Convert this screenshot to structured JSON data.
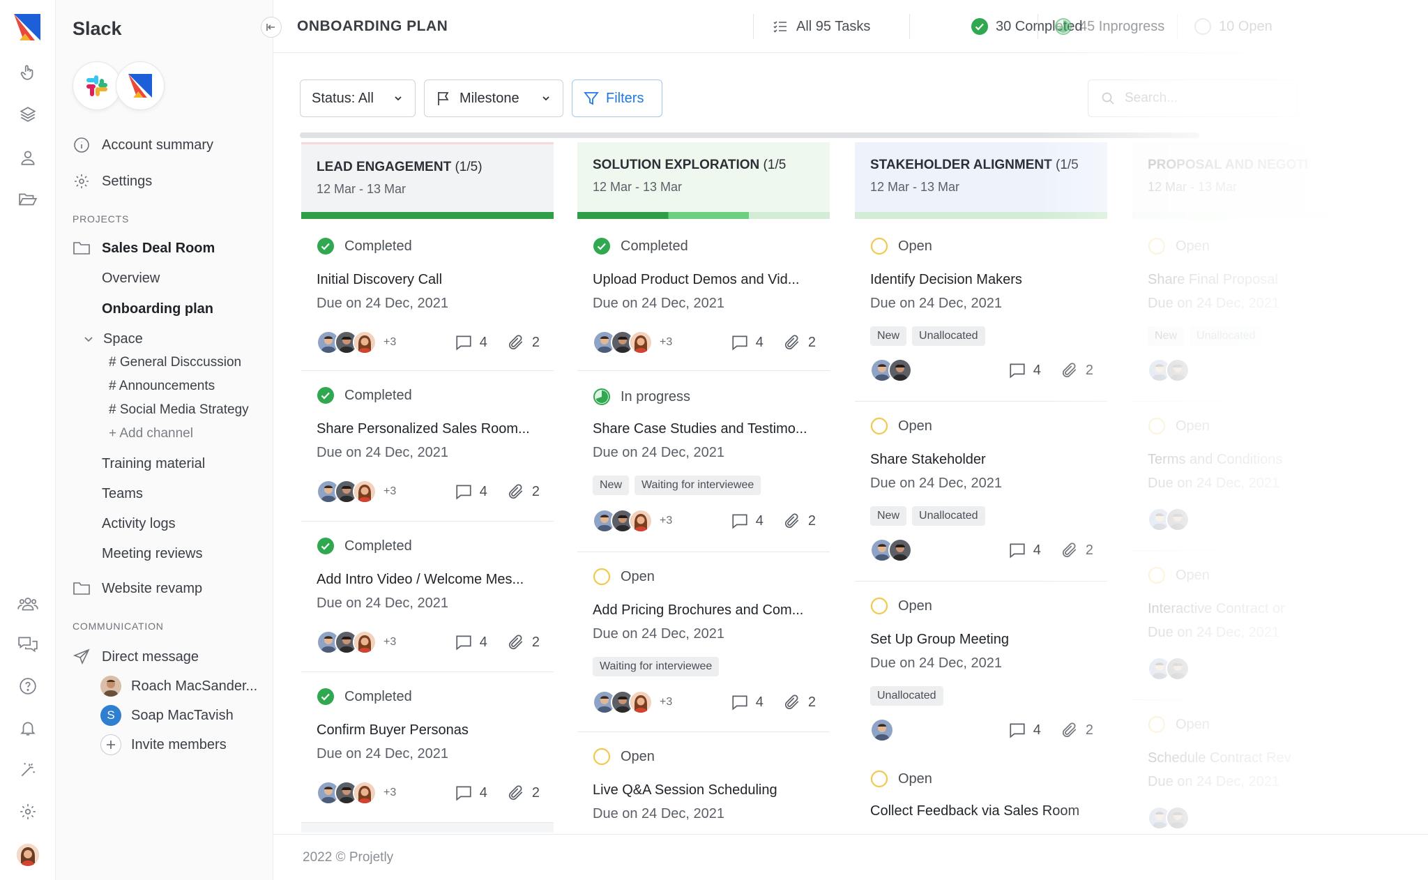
{
  "workspace": {
    "name": "Slack",
    "logos": [
      "slack-logo",
      "projetly-logo"
    ]
  },
  "rail": {
    "items": [
      "hand-pointer-icon",
      "layers-icon",
      "user-icon",
      "folder-open-icon",
      "team-icon",
      "chat-icon",
      "help-icon",
      "bell-icon",
      "magic-wand-icon",
      "gear-icon"
    ]
  },
  "sidebar": {
    "account_summary": "Account summary",
    "settings": "Settings",
    "projects_label": "PROJECTS",
    "projects": [
      {
        "name": "Sales Deal Room"
      },
      {
        "name": "Website revamp"
      }
    ],
    "project_items": {
      "overview": "Overview",
      "onboarding": "Onboarding plan",
      "space": "Space",
      "channels": [
        "# General Disccussion",
        "# Announcements",
        "# Social Media Strategy"
      ],
      "add_channel": "+ Add channel",
      "training": "Training material",
      "teams": "Teams",
      "activity": "Activity logs",
      "meetings": "Meeting reviews"
    },
    "communication_label": "COMMUNICATION",
    "direct_message": "Direct message",
    "dms": [
      {
        "name": "Roach MacSander...",
        "initial": ""
      },
      {
        "name": "Soap MacTavish",
        "initial": "S"
      }
    ],
    "invite": "Invite members"
  },
  "topbar": {
    "title": "ONBOARDING PLAN",
    "all_tasks": "All 95 Tasks",
    "completed": "30 Completed",
    "inprogress": "45 Inprogress",
    "open": "10 Open"
  },
  "toolbar": {
    "status": "Status: All",
    "milestone": "Milestone",
    "filters": "Filters",
    "search_placeholder": "Search..."
  },
  "columns": [
    {
      "title": "LEAD ENGAGEMENT",
      "count": "(1/5)",
      "dates": "12 Mar - 13 Mar",
      "progress": 1.0,
      "cards": [
        {
          "status": "Completed",
          "title": "Initial Discovery Call",
          "due": "Due on 24 Dec, 2021",
          "more": "+3",
          "comments": "4",
          "attachments": "2"
        },
        {
          "status": "Completed",
          "title": "Share Personalized Sales Room...",
          "due": "Due on 24 Dec, 2021",
          "more": "+3",
          "comments": "4",
          "attachments": "2"
        },
        {
          "status": "Completed",
          "title": "Add Intro Video / Welcome Mes...",
          "due": "Due on 24 Dec, 2021",
          "more": "+3",
          "comments": "4",
          "attachments": "2"
        },
        {
          "status": "Completed",
          "title": "Confirm Buyer Personas",
          "due": "Due on 24 Dec, 2021",
          "more": "+3",
          "comments": "4",
          "attachments": "2"
        }
      ]
    },
    {
      "title": "SOLUTION EXPLORATION",
      "count": "(1/5",
      "dates": "12 Mar - 13 Mar",
      "progress": 0.68,
      "cards": [
        {
          "status": "Completed",
          "title": "Upload Product Demos and Vid...",
          "due": "Due on 24 Dec, 2021",
          "more": "+3",
          "comments": "4",
          "attachments": "2"
        },
        {
          "status": "In progress",
          "title": "Share Case Studies and Testimo...",
          "due": "Due on 24 Dec, 2021",
          "tags": [
            "New",
            "Waiting for interviewee"
          ],
          "more": "+3",
          "comments": "4",
          "attachments": "2"
        },
        {
          "status": "Open",
          "title": "Add Pricing Brochures and Com...",
          "due": "Due on 24 Dec, 2021",
          "tags": [
            "Waiting for interviewee"
          ],
          "more": "+3",
          "comments": "4",
          "attachments": "2"
        },
        {
          "status": "Open",
          "title": "Live Q&A Session Scheduling",
          "due": "Due on 24 Dec, 2021"
        }
      ]
    },
    {
      "title": "STAKEHOLDER ALIGNMENT",
      "count": "(1/5",
      "dates": "12 Mar - 13 Mar",
      "progress": 0,
      "cards": [
        {
          "status": "Open",
          "title": "Identify Decision Makers",
          "due": "Due on 24 Dec, 2021",
          "tags": [
            "New",
            "Unallocated"
          ],
          "comments": "4",
          "attachments": "2"
        },
        {
          "status": "Open",
          "title": "Share Stakeholder",
          "due": "Due on 24 Dec, 2021",
          "tags": [
            "New",
            "Unallocated"
          ],
          "comments": "4",
          "attachments": "2"
        },
        {
          "status": "Open",
          "title": "Set Up Group Meeting",
          "due": "Due on 24 Dec, 2021",
          "tags": [
            "Unallocated"
          ],
          "comments": "4",
          "attachments": "2"
        },
        {
          "status": "Open",
          "title": "Collect Feedback via Sales Room"
        }
      ]
    },
    {
      "title": "PROPOSAL AND NEGOTI",
      "dates": "12 Mar - 13 Mar",
      "progress": 0,
      "cards": [
        {
          "status": "Open",
          "title": "Share Final Proposal",
          "due": "Due on 24 Dec, 2021",
          "tags": [
            "New",
            "Unallocated"
          ]
        },
        {
          "status": "Open",
          "title": "Terms and Conditions",
          "due": "Due on 24 Dec, 2021"
        },
        {
          "status": "Open",
          "title": "Interactive Contract or",
          "due": "Due on 24 Dec, 2021"
        },
        {
          "status": "Open",
          "title": "Schedule Contract Rev",
          "due": "Due on 24 Dec, 2021"
        }
      ]
    }
  ],
  "footer": "2022 © Projetly",
  "colors": {
    "accent_blue": "#1f7ae0",
    "completed_green": "#2fa84f",
    "progress_green": "#2e9e47",
    "progress_light": "#6dd07f",
    "open_yellow": "#f2c94c",
    "col_lead_bg": "#f4f5f6",
    "col_solution_bg": "#eef8ef",
    "col_stakeholder_bg": "#eef3fb"
  }
}
